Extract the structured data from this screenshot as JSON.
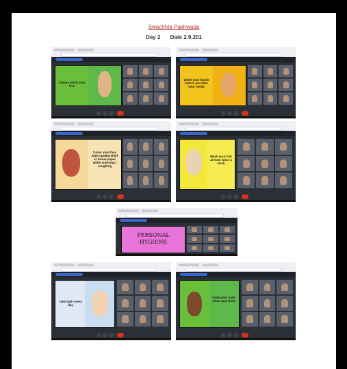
{
  "document": {
    "title": "Swachhta  Pakhwada",
    "day_label": "Day 2",
    "date_label": "Date  2.9.201"
  },
  "screens": [
    {
      "id": "s1",
      "slide_text": "Always wash your feet",
      "slide_bg": "#6abf3a",
      "left_bg": "#6abf3a"
    },
    {
      "id": "s2",
      "slide_text": "Wash your hands before and after your meals",
      "slide_bg": "#f2c31d",
      "left_bg": "#f2c31d"
    },
    {
      "id": "s3",
      "slide_text": "Cover your face with handkerchief or tissue paper while sneezing / coughing",
      "slide_bg": "#f5d89a",
      "left_bg": "#f5d89a"
    },
    {
      "id": "s4",
      "slide_text": "Wash your hair at least twice a week",
      "slide_bg": "#f3e83a",
      "left_bg": "#f3e83a"
    },
    {
      "id": "s5",
      "slide_text": "PERSONAL HYGIENE",
      "slide_bg": "#e874d9",
      "left_bg": "#e874d9"
    },
    {
      "id": "s6",
      "slide_text": "Take bath every day",
      "slide_bg": "#dfe9f5",
      "left_bg": "#dfe9f5"
    },
    {
      "id": "s7",
      "slide_text": "Keep your nails clean and short",
      "slide_bg": "#6abf3a",
      "left_bg": "#6abf3a"
    }
  ],
  "colors": {
    "title_red": "#b5322a",
    "meet_dark": "#2b2f36",
    "end_call_red": "#d93025"
  }
}
